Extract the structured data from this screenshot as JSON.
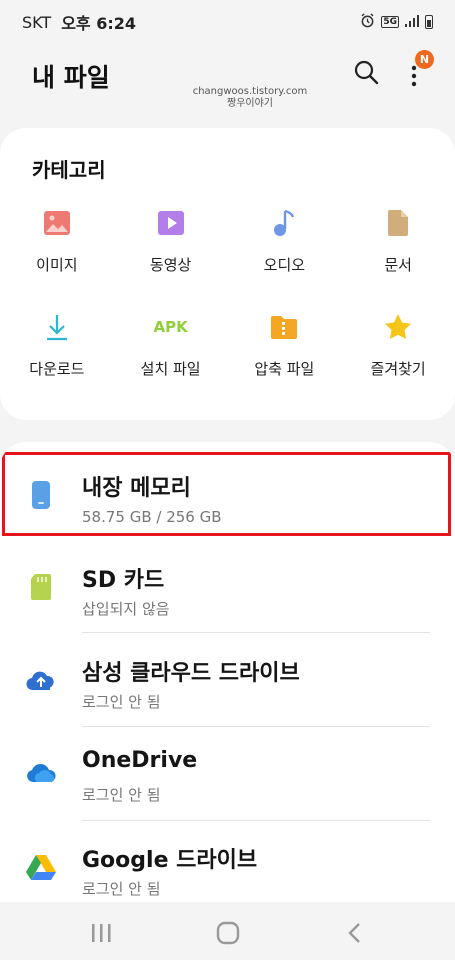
{
  "status_bar": {
    "carrier": "SKT",
    "time": "오후 6:24",
    "network": "5G"
  },
  "header": {
    "title": "내 파일",
    "badge": "N"
  },
  "watermark": {
    "line1": "changwoos.tistory.com",
    "line2": "짱우이야기"
  },
  "category": {
    "title": "카테고리",
    "items": [
      {
        "label": "이미지",
        "icon": "image-icon",
        "color": "#ef7a73"
      },
      {
        "label": "동영상",
        "icon": "video-icon",
        "color": "#b37ee9"
      },
      {
        "label": "오디오",
        "icon": "music-note-icon",
        "color": "#6f97e6"
      },
      {
        "label": "문서",
        "icon": "document-icon",
        "color": "#d0ad7a"
      },
      {
        "label": "다운로드",
        "icon": "download-icon",
        "color": "#2eb5cf"
      },
      {
        "label": "설치 파일",
        "icon": "apk-icon",
        "icon_text": "APK",
        "color": "#8fcf3a"
      },
      {
        "label": "압축 파일",
        "icon": "zip-folder-icon",
        "color": "#f5a623"
      },
      {
        "label": "즐겨찾기",
        "icon": "star-icon",
        "color": "#f5c518"
      }
    ]
  },
  "storage": {
    "items": [
      {
        "name": "내장 메모리",
        "sub": "58.75 GB / 256 GB",
        "icon": "phone-storage-icon",
        "color": "#5aa0e6"
      },
      {
        "name": "SD 카드",
        "sub": "삽입되지 않음",
        "icon": "sd-card-icon",
        "color": "#b5d34e"
      },
      {
        "name": "삼성 클라우드 드라이브",
        "sub": "로그인 안 됨",
        "icon": "samsung-cloud-icon",
        "color": "#2f6fd0"
      },
      {
        "name": "OneDrive",
        "sub": "로그인 안 됨",
        "icon": "onedrive-icon",
        "color": "#1f7bd8"
      },
      {
        "name": "Google 드라이브",
        "sub": "로그인 안 됨",
        "icon": "google-drive-icon",
        "color": "#34a853"
      }
    ]
  },
  "colors": {
    "highlight": "#e8141b",
    "badge": "#f06a1d"
  }
}
